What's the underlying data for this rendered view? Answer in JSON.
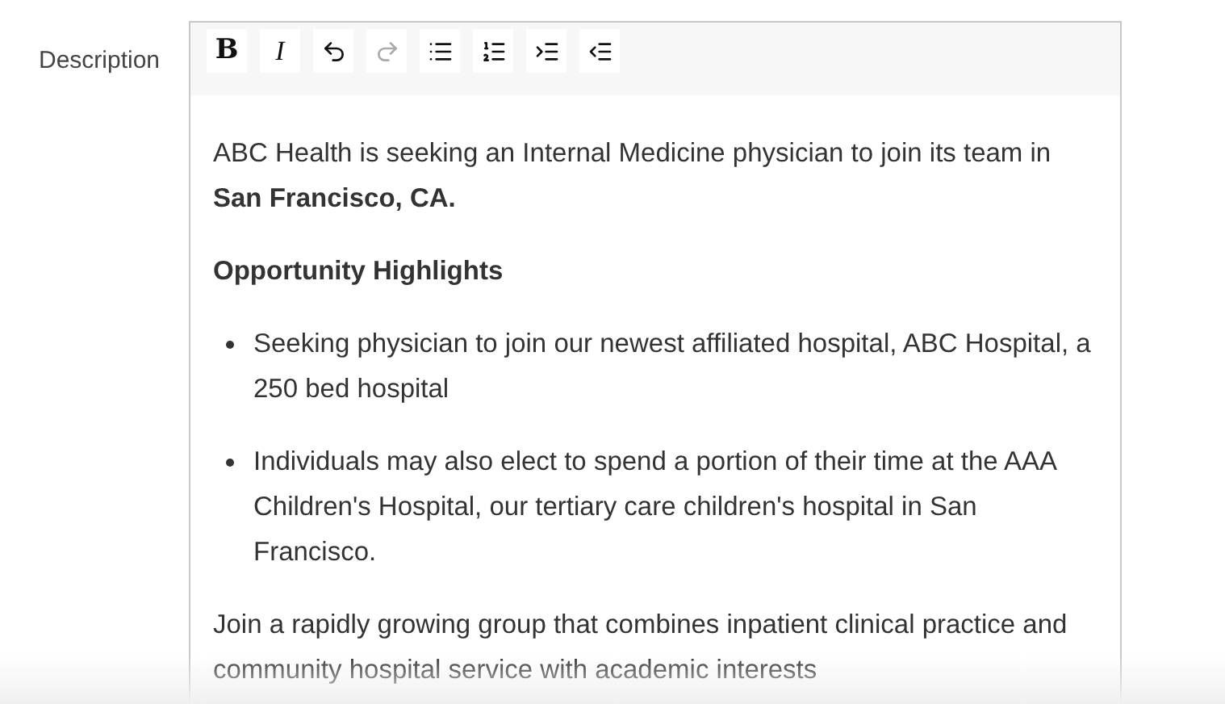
{
  "field_label": "Description",
  "toolbar": [
    {
      "kind": "bold",
      "label": "B",
      "disabled": false
    },
    {
      "kind": "italic",
      "label": "I",
      "disabled": false
    },
    {
      "kind": "undo",
      "disabled": false
    },
    {
      "kind": "redo",
      "disabled": true
    },
    {
      "kind": "bullet_list",
      "disabled": false
    },
    {
      "kind": "numbered_list",
      "disabled": false
    },
    {
      "kind": "indent",
      "disabled": false
    },
    {
      "kind": "outdent",
      "disabled": false
    }
  ],
  "content": [
    {
      "kind": "paragraph",
      "text": "ABC Health is seeking an Internal Medicine physician to join its team in **San Francisco, CA.**"
    },
    {
      "kind": "heading",
      "text": "Opportunity Highlights"
    },
    {
      "kind": "bullets",
      "items": [
        "Seeking physician to join our newest affiliated hospital, ABC Hospital, a 250 bed hospital",
        "Individuals may also elect to spend a portion of their time at the AAA Children's Hospital, our tertiary care children's hospital in San Francisco."
      ]
    },
    {
      "kind": "paragraph",
      "text": "Join a rapidly growing group that combines inpatient clinical practice and community hospital service with academic interests"
    }
  ]
}
